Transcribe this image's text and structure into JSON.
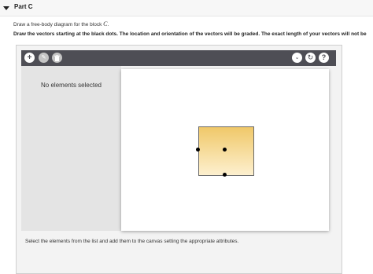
{
  "part": {
    "title": "Part C"
  },
  "instructions": {
    "line1_prefix": "Draw a free-body diagram for the block ",
    "line1_var": "C",
    "line1_suffix": ".",
    "line2": "Draw the vectors starting at the black dots. The location and orientation of the vectors will be graded. The exact length of your vectors will not be"
  },
  "toolbar": {
    "add_icon": "+",
    "edit_icon": "✎",
    "trash_icon": "🗑",
    "chevron_icon": "⌄",
    "reset_icon": "↻",
    "help_icon": "?"
  },
  "side_panel": {
    "empty_text": "No elements selected"
  },
  "status": {
    "text": "Select the elements from the list and add them to the canvas setting the appropriate attributes."
  }
}
